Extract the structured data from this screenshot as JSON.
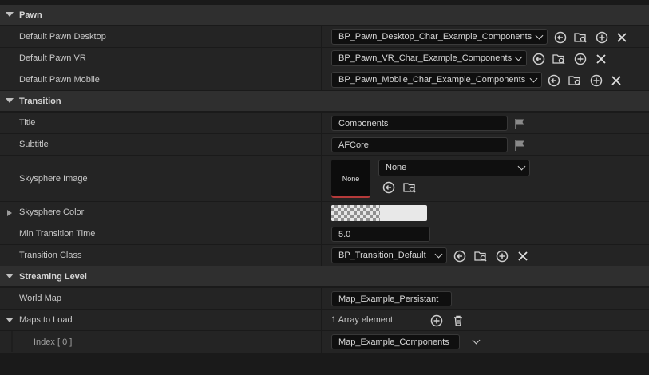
{
  "categories": {
    "pawn": "Pawn",
    "transition": "Transition",
    "streaming": "Streaming Level"
  },
  "pawn": {
    "desktop": {
      "label": "Default Pawn Desktop",
      "value": "BP_Pawn_Desktop_Char_Example_Components"
    },
    "vr": {
      "label": "Default Pawn VR",
      "value": "BP_Pawn_VR_Char_Example_Components"
    },
    "mobile": {
      "label": "Default Pawn Mobile",
      "value": "BP_Pawn_Mobile_Char_Example_Components"
    }
  },
  "transition": {
    "title": {
      "label": "Title",
      "value": "Components"
    },
    "subtitle": {
      "label": "Subtitle",
      "value": "AFCore"
    },
    "skysphere_image": {
      "label": "Skysphere Image",
      "thumb": "None",
      "value": "None"
    },
    "skysphere_color": {
      "label": "Skysphere Color",
      "color_rgb": "#e8e8e8"
    },
    "min_time": {
      "label": "Min Transition Time",
      "value": "5.0"
    },
    "class": {
      "label": "Transition Class",
      "value": "BP_Transition_Default"
    }
  },
  "streaming": {
    "world_map": {
      "label": "World Map",
      "value": "Map_Example_Persistant"
    },
    "maps_to_load": {
      "label": "Maps to Load",
      "count": "1 Array element"
    },
    "index0": {
      "label": "Index [ 0 ]",
      "value": "Map_Example_Components"
    }
  },
  "icons": {
    "use_selected": "arrow-left-circle-icon",
    "browse": "folder-search-icon",
    "add": "plus-circle-icon",
    "clear": "close-icon",
    "localize": "flag-icon",
    "delete": "trash-icon"
  }
}
